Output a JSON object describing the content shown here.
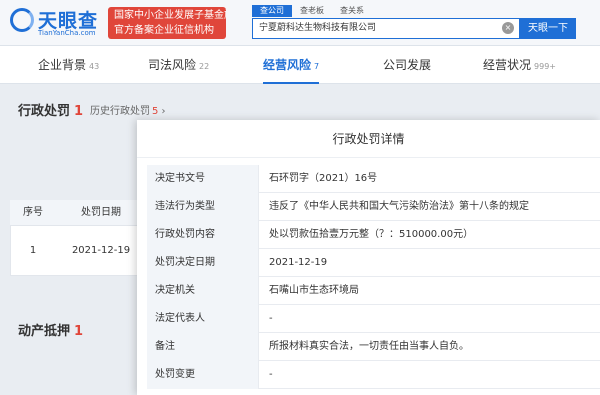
{
  "header": {
    "logo_text": "天眼查",
    "logo_sub": "TianYanCha.com",
    "badge_line1": "国家中小企业发展子基金旗下",
    "badge_line2": "官方备案企业征信机构",
    "search_tabs": [
      "查公司",
      "查老板",
      "查关系"
    ],
    "search_value": "宁夏蔚科达生物科技有限公司",
    "search_button": "天眼一下"
  },
  "nav": [
    {
      "label": "企业背景",
      "count": "43"
    },
    {
      "label": "司法风险",
      "count": "22"
    },
    {
      "label": "经营风险",
      "count": "7"
    },
    {
      "label": "公司发展",
      "count": ""
    },
    {
      "label": "经营状况",
      "count": "999+"
    }
  ],
  "page": {
    "section1_title": "行政处罚",
    "section1_count": "1",
    "history_label": "历史行政处罚",
    "history_count": "5",
    "table_headers": [
      "序号",
      "处罚日期"
    ],
    "table_row": [
      "1",
      "2021-12-19"
    ],
    "section2_title": "动产抵押",
    "section2_count": "1"
  },
  "modal": {
    "title": "行政处罚详情",
    "rows": [
      {
        "label": "决定书文号",
        "value": "石环罚字（2021）16号"
      },
      {
        "label": "违法行为类型",
        "value": "违反了《中华人民共和国大气污染防治法》第十八条的规定"
      },
      {
        "label": "行政处罚内容",
        "value": "处以罚款伍拾壹万元整（？：510000.00元）"
      },
      {
        "label": "处罚决定日期",
        "value": "2021-12-19"
      },
      {
        "label": "决定机关",
        "value": "石嘴山市生态环境局"
      },
      {
        "label": "法定代表人",
        "value": "-"
      },
      {
        "label": "备注",
        "value": "所报材料真实合法，一切责任由当事人自负。"
      },
      {
        "label": "处罚变更",
        "value": "-"
      }
    ]
  },
  "colors": {
    "brand": "#1f6fd6",
    "badge": "#e0463a"
  }
}
